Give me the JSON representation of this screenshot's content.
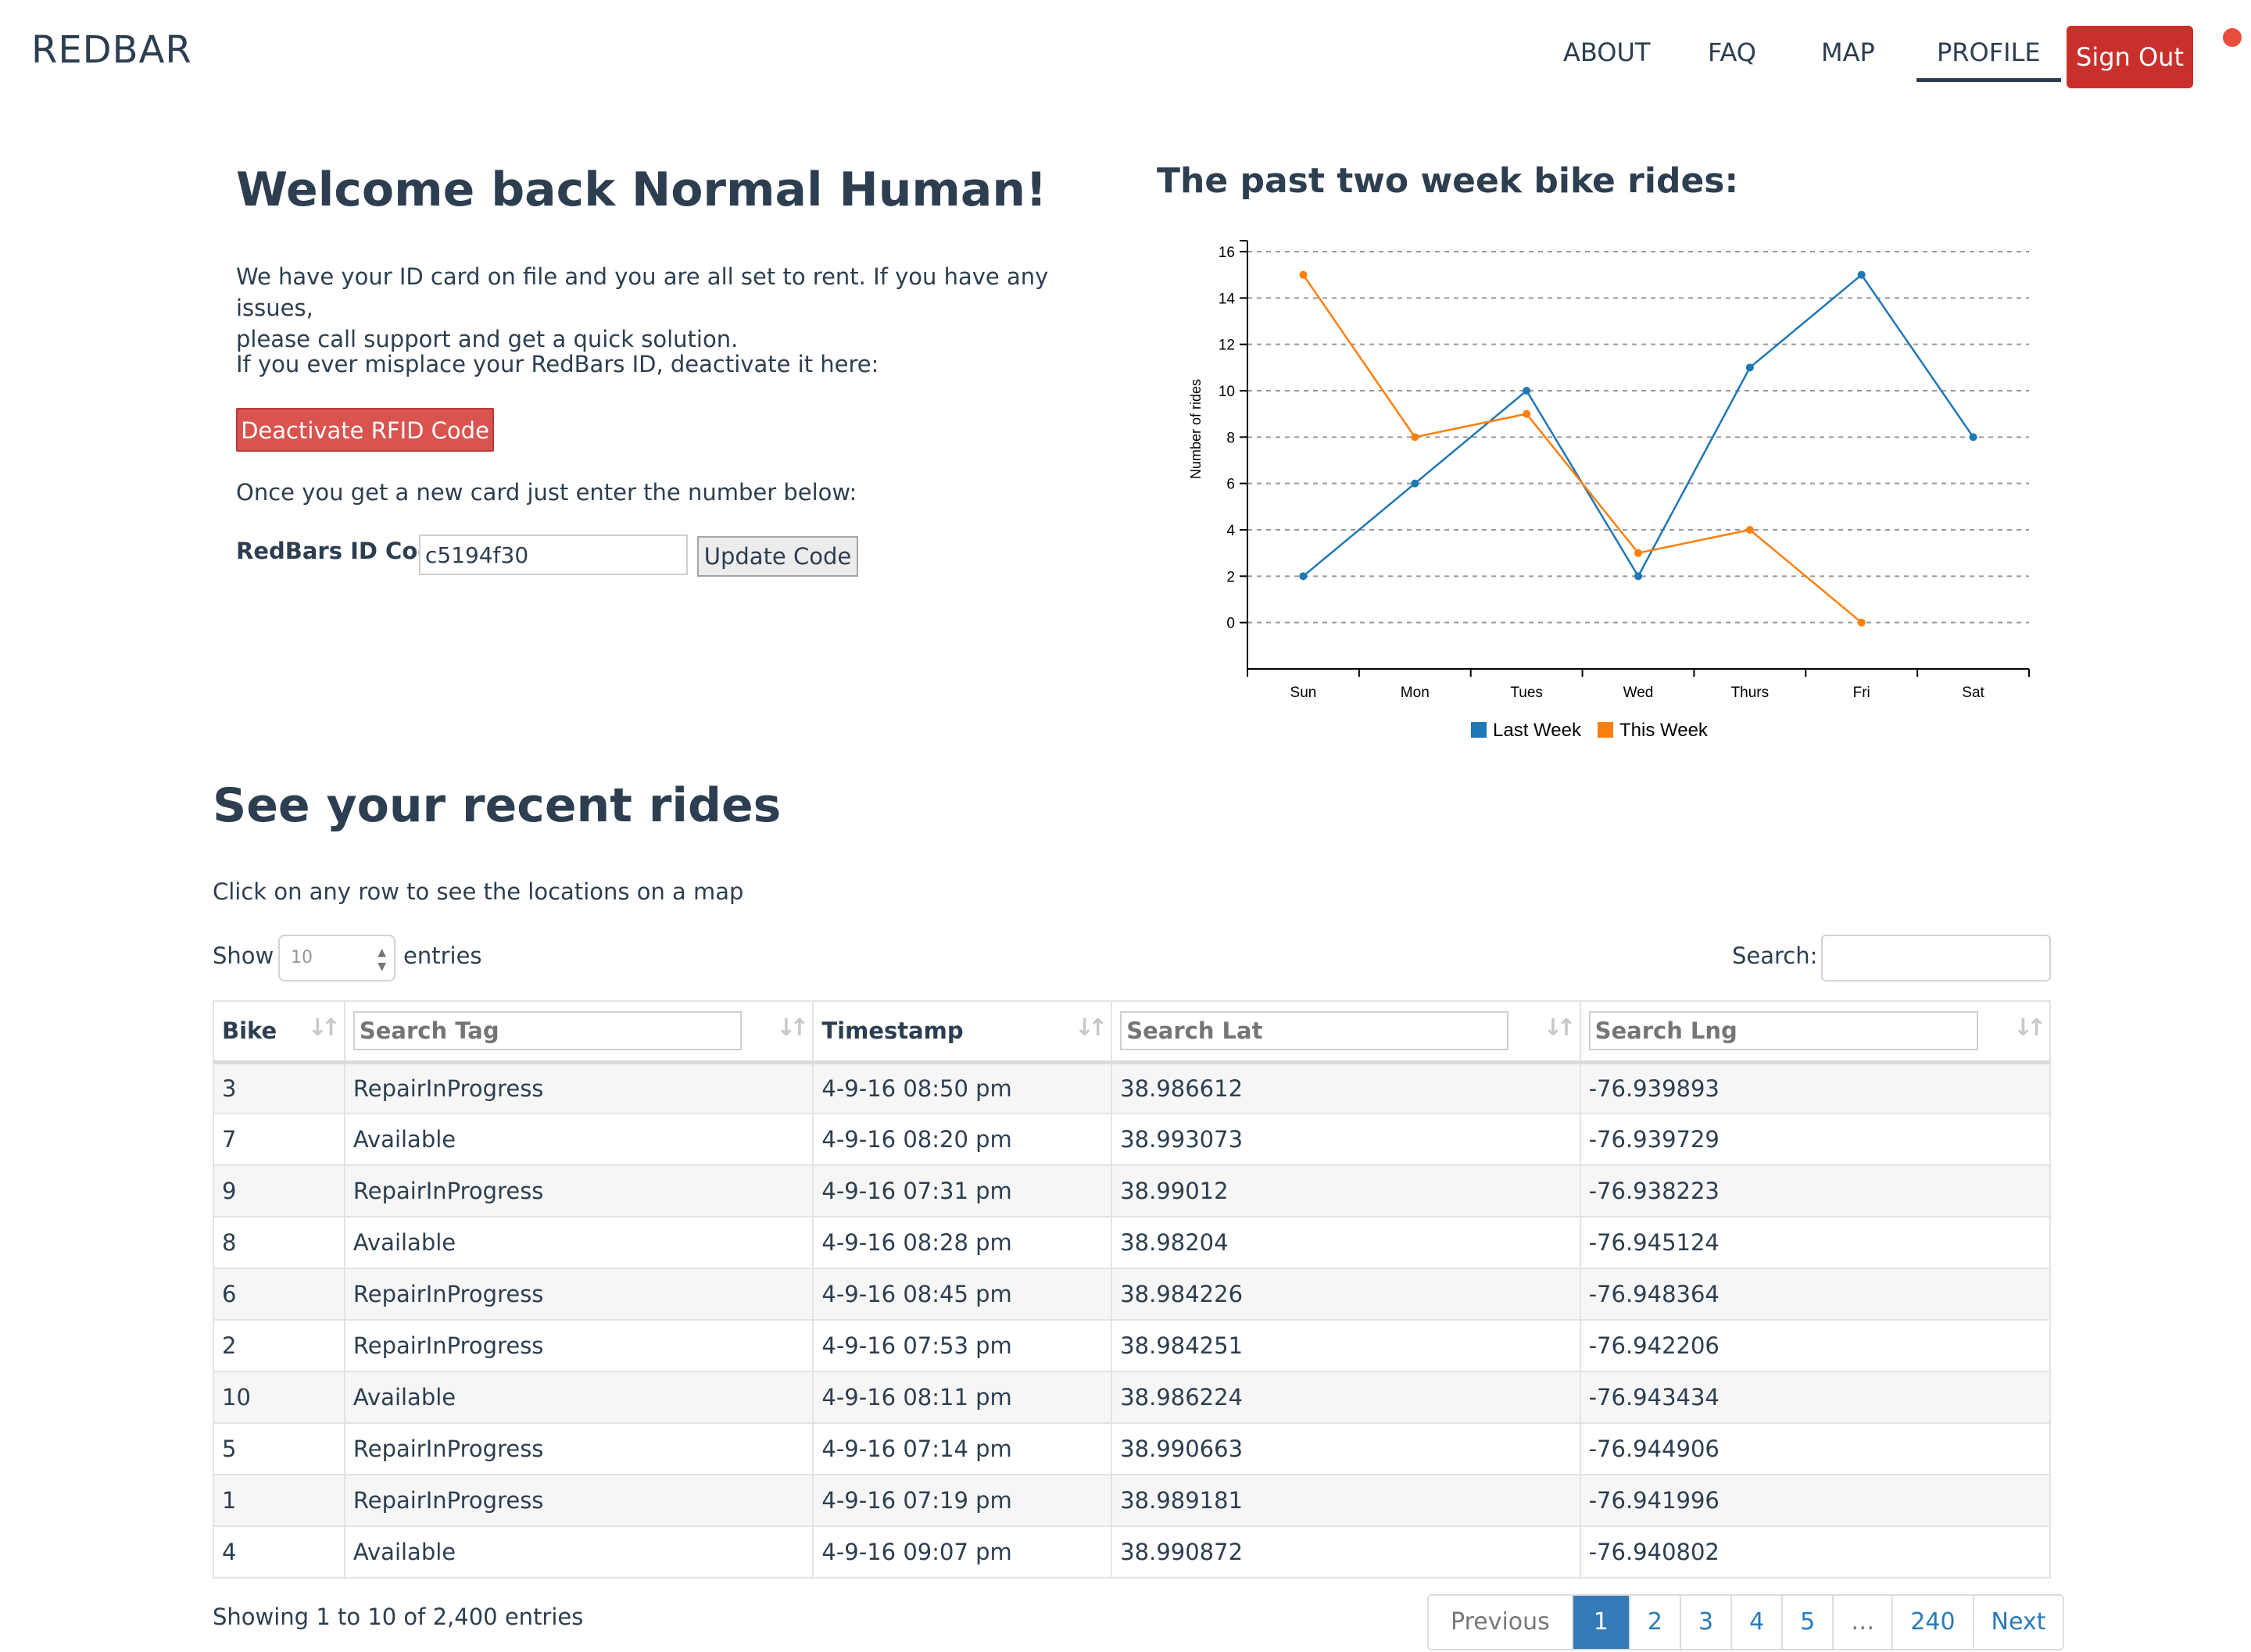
{
  "nav": {
    "brand": "REDBAR",
    "links": [
      "ABOUT",
      "FAQ",
      "MAP",
      "PROFILE"
    ],
    "active": "PROFILE",
    "sign_out": "Sign Out"
  },
  "welcome": {
    "title": "Welcome back Normal Human!",
    "p1_line1": "We have your ID card on file and you are all set to rent. If you have any issues,",
    "p1_line2": "please call support and get a quick solution.",
    "p2": "If you ever misplace your RedBars ID, deactivate it here:",
    "deactivate_label": "Deactivate RFID Code",
    "p3": "Once you get a new card just enter the number below:",
    "id_label": "RedBars ID Code",
    "id_value": "c5194f30",
    "update_label": "Update Code"
  },
  "chart": {
    "title": "The past two week bike rides:"
  },
  "chart_data": {
    "type": "line",
    "categories": [
      "Sun",
      "Mon",
      "Tues",
      "Wed",
      "Thurs",
      "Fri",
      "Sat"
    ],
    "series": [
      {
        "name": "Last Week",
        "color": "#1f77b4",
        "values": [
          2,
          6,
          10,
          2,
          11,
          15,
          8
        ]
      },
      {
        "name": "This Week",
        "color": "#ff7f0e",
        "values": [
          15,
          8,
          9,
          3,
          4,
          0,
          null
        ]
      }
    ],
    "ylabel": "Number of rides",
    "xlabel": "",
    "ylim": [
      -2,
      16
    ],
    "yticks": [
      0,
      2,
      4,
      6,
      8,
      10,
      12,
      14,
      16
    ],
    "grid": true,
    "legend": "bottom"
  },
  "rides": {
    "title": "See your recent rides",
    "subtitle": "Click on any row to see the locations on a map",
    "show_label": "Show",
    "entries_value": "10",
    "entries_label": "entries",
    "search_label": "Search:",
    "columns": {
      "bike": "Bike",
      "tag_placeholder": "Search Tag",
      "timestamp": "Timestamp",
      "lat_placeholder": "Search Lat",
      "lng_placeholder": "Search Lng"
    },
    "rows": [
      [
        "3",
        "RepairInProgress",
        "4-9-16 08:50 pm",
        "38.986612",
        "-76.939893"
      ],
      [
        "7",
        "Available",
        "4-9-16 08:20 pm",
        "38.993073",
        "-76.939729"
      ],
      [
        "9",
        "RepairInProgress",
        "4-9-16 07:31 pm",
        "38.99012",
        "-76.938223"
      ],
      [
        "8",
        "Available",
        "4-9-16 08:28 pm",
        "38.98204",
        "-76.945124"
      ],
      [
        "6",
        "RepairInProgress",
        "4-9-16 08:45 pm",
        "38.984226",
        "-76.948364"
      ],
      [
        "2",
        "RepairInProgress",
        "4-9-16 07:53 pm",
        "38.984251",
        "-76.942206"
      ],
      [
        "10",
        "Available",
        "4-9-16 08:11 pm",
        "38.986224",
        "-76.943434"
      ],
      [
        "5",
        "RepairInProgress",
        "4-9-16 07:14 pm",
        "38.990663",
        "-76.944906"
      ],
      [
        "1",
        "RepairInProgress",
        "4-9-16 07:19 pm",
        "38.989181",
        "-76.941996"
      ],
      [
        "4",
        "Available",
        "4-9-16 09:07 pm",
        "38.990872",
        "-76.940802"
      ]
    ],
    "showing": "Showing 1 to 10 of 2,400 entries",
    "pagination": [
      "Previous",
      "1",
      "2",
      "3",
      "4",
      "5",
      "…",
      "240",
      "Next"
    ],
    "current_page": "1"
  }
}
